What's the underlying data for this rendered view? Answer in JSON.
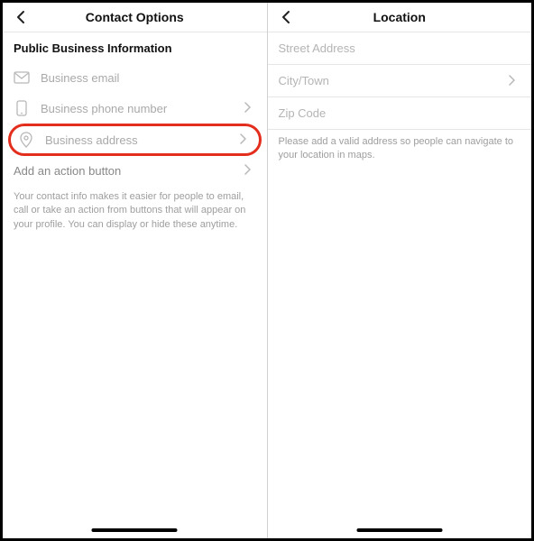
{
  "left": {
    "title": "Contact Options",
    "section_header": "Public Business Information",
    "rows": {
      "email": "Business email",
      "phone": "Business phone number",
      "address": "Business address",
      "action_button": "Add an action button"
    },
    "description": "Your contact info makes it easier for people to email, call or take an action from buttons that will appear on your profile. You can display or hide these anytime."
  },
  "right": {
    "title": "Location",
    "fields": {
      "street": "Street Address",
      "city": "City/Town",
      "zip": "Zip Code"
    },
    "description": "Please add a valid address so people can navigate to your location in maps."
  },
  "colors": {
    "placeholder": "#a9a9a9",
    "text_muted": "#9e9e9e",
    "highlight_border": "#e42e1d"
  }
}
